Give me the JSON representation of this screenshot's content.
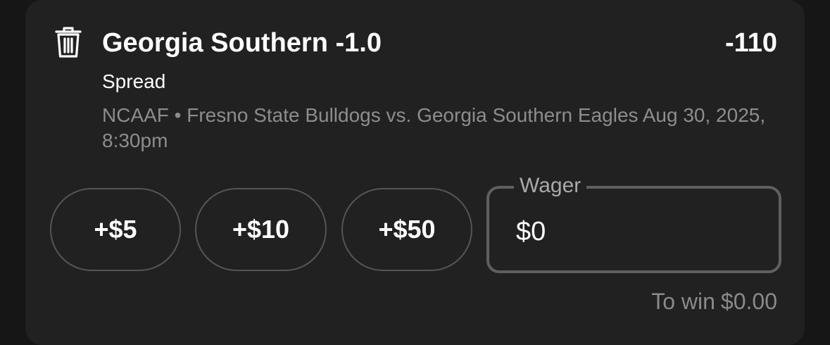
{
  "bet": {
    "selection": "Georgia Southern -1.0",
    "odds": "-110",
    "market": "Spread",
    "event": "NCAAF • Fresno State Bulldogs vs. Georgia Southern Eagles Aug 30, 2025, 8:30pm"
  },
  "quick_add": [
    {
      "label": "+$5"
    },
    {
      "label": "+$10"
    },
    {
      "label": "+$50"
    }
  ],
  "wager": {
    "label": "Wager",
    "value": "$0"
  },
  "payout": {
    "label": "To win",
    "amount": "$0.00"
  },
  "icons": {
    "remove": "trash-icon"
  },
  "colors": {
    "background": "#161616",
    "card": "#212121",
    "muted_text": "#8d8d8d",
    "border": "#555555"
  }
}
